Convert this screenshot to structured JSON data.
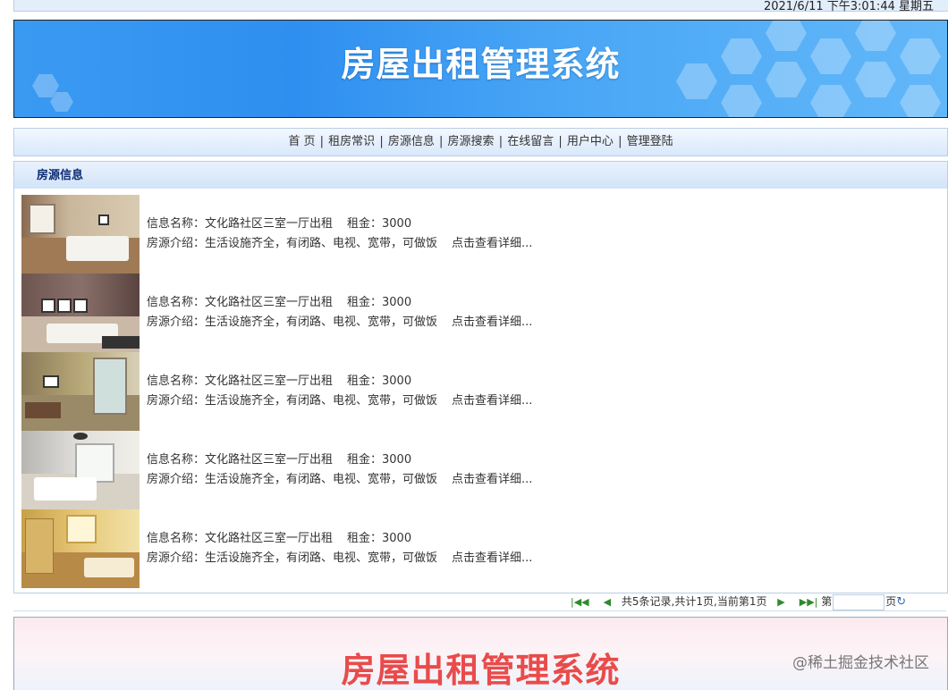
{
  "header": {
    "datetime": "2021/6/11 下午3:01:44  星期五"
  },
  "banner": {
    "title": "房屋出租管理系统"
  },
  "nav": {
    "items": [
      {
        "label": "首 页"
      },
      {
        "label": "租房常识"
      },
      {
        "label": "房源信息"
      },
      {
        "label": "房源搜索"
      },
      {
        "label": "在线留言"
      },
      {
        "label": "用户中心"
      },
      {
        "label": "管理登陆"
      }
    ]
  },
  "panel": {
    "title": "房源信息"
  },
  "listings": [
    {
      "name_line": "信息名称：文化路社区三室一厅出租",
      "rent_line": "租金：3000",
      "desc_line": "房源介绍：生活设施齐全，有闭路、电视、宽带，可做饭",
      "detail_link": "点击查看详细..."
    },
    {
      "name_line": "信息名称：文化路社区三室一厅出租",
      "rent_line": "租金：3000",
      "desc_line": "房源介绍：生活设施齐全，有闭路、电视、宽带，可做饭",
      "detail_link": "点击查看详细..."
    },
    {
      "name_line": "信息名称：文化路社区三室一厅出租",
      "rent_line": "租金：3000",
      "desc_line": "房源介绍：生活设施齐全，有闭路、电视、宽带，可做饭",
      "detail_link": "点击查看详细..."
    },
    {
      "name_line": "信息名称：文化路社区三室一厅出租",
      "rent_line": "租金：3000",
      "desc_line": "房源介绍：生活设施齐全，有闭路、电视、宽带，可做饭",
      "detail_link": "点击查看详细..."
    },
    {
      "name_line": "信息名称：文化路社区三室一厅出租",
      "rent_line": "租金：3000",
      "desc_line": "房源介绍：生活设施齐全，有闭路、电视、宽带，可做饭",
      "detail_link": "点击查看详细..."
    }
  ],
  "pager": {
    "summary": "共5条记录,共计1页,当前第1页",
    "page_prefix": "第",
    "page_suffix": "页",
    "page_input_value": ""
  },
  "footer": {
    "title": "房屋出租管理系统",
    "watermark": "@稀土掘金技术社区"
  },
  "colors": {
    "banner_blue": "#3a9af2",
    "nav_bg": "#d8e8fb",
    "panel_title": "#0b2a72",
    "footer_title": "#e94b4b",
    "pager_icon": "#2e8b2e"
  },
  "icons": {
    "first": "first-page-icon",
    "prev": "prev-page-icon",
    "next": "next-page-icon",
    "last": "last-page-icon",
    "go": "go-refresh-icon"
  }
}
